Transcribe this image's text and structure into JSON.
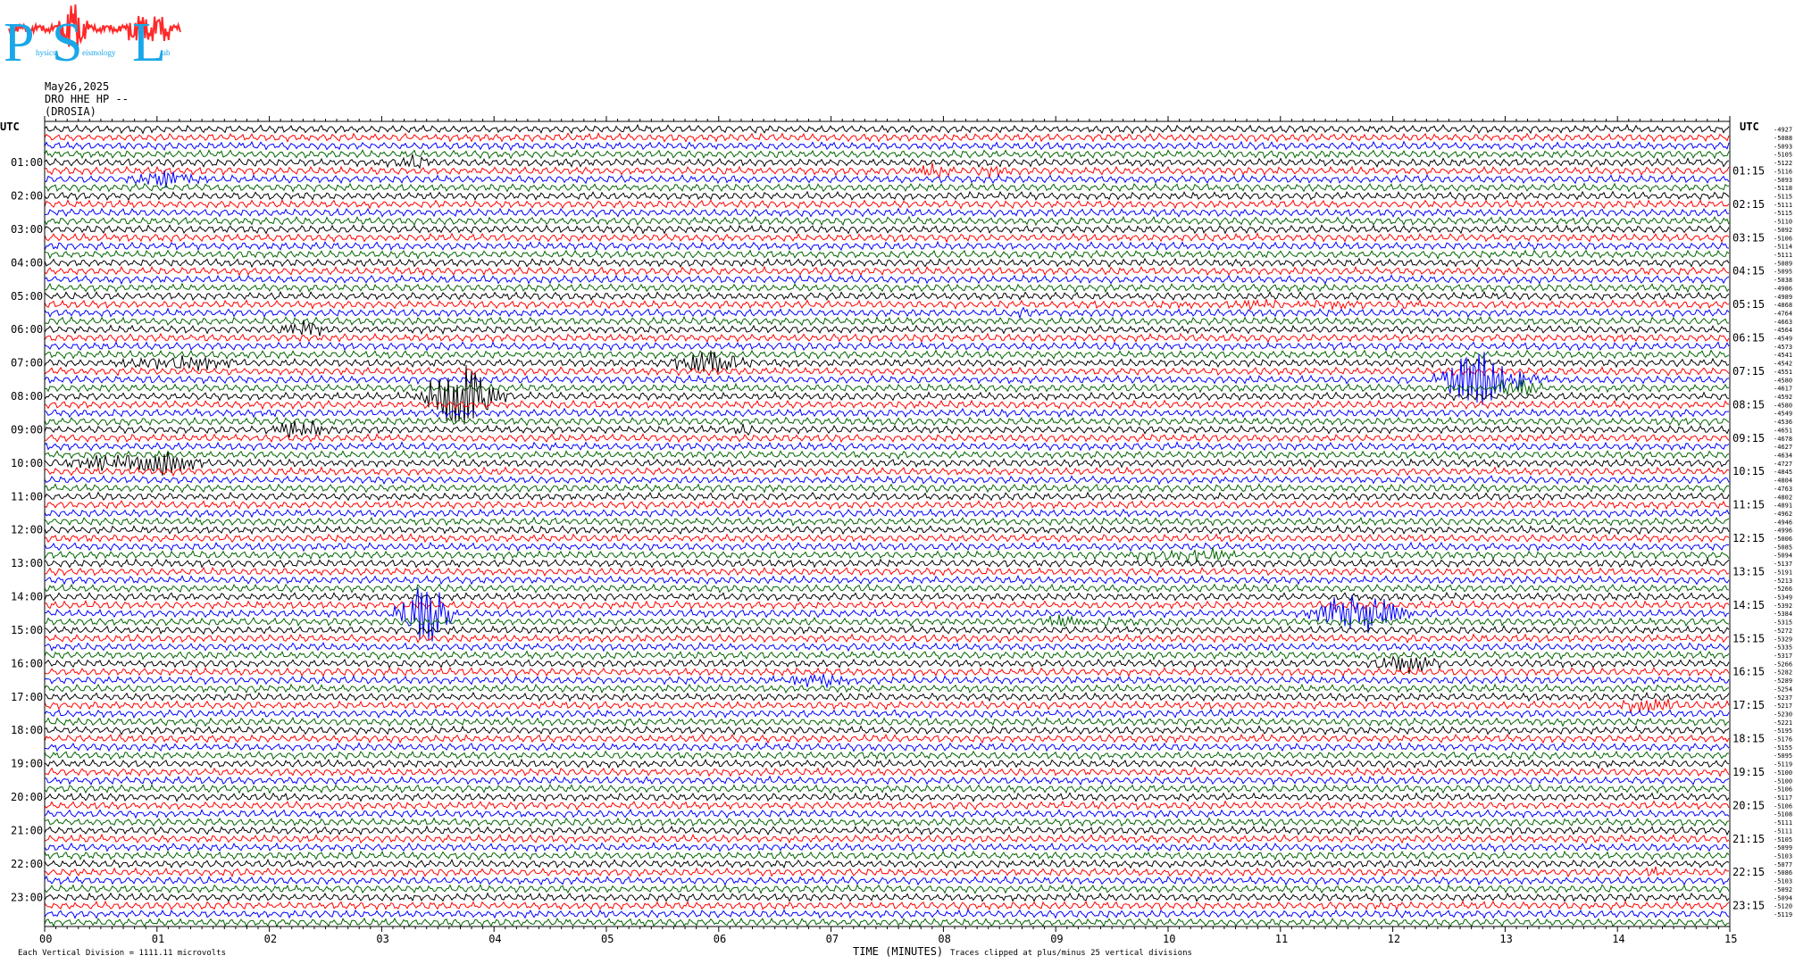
{
  "logo": {
    "letters": [
      "P",
      "S",
      "L"
    ],
    "subtitle_fragments": [
      "hysics",
      "eismology",
      "ab"
    ],
    "colors": {
      "letters": "#1aa7e8",
      "trace": "#ff2a2a"
    }
  },
  "header": {
    "date": "May26,2025",
    "channel": "DRO HHE HP --",
    "station": "(DROSIA)"
  },
  "footer": {
    "left_note": "Each Vertical Division = 1111.11 microvolts",
    "x_axis_label": "TIME (MINUTES)",
    "clip_note": "Traces clipped at plus/minus 25 vertical divisions"
  },
  "chart_data": {
    "type": "line",
    "title": "",
    "xlabel": "TIME (MINUTES)",
    "ylabel": "UTC",
    "xlim": [
      0,
      15
    ],
    "x_ticks": [
      "00",
      "01",
      "02",
      "03",
      "04",
      "05",
      "06",
      "07",
      "08",
      "09",
      "10",
      "11",
      "12",
      "13",
      "14",
      "15"
    ],
    "left_axis_title": "UTC",
    "right_axis_title": "UTC",
    "left_hour_labels": [
      "01:00",
      "02:00",
      "03:00",
      "04:00",
      "05:00",
      "06:00",
      "07:00",
      "08:00",
      "09:00",
      "10:00",
      "11:00",
      "12:00",
      "13:00",
      "14:00",
      "15:00",
      "16:00",
      "17:00",
      "18:00",
      "19:00",
      "20:00",
      "21:00",
      "22:00",
      "23:00"
    ],
    "right_hour_labels": [
      "01:15",
      "02:15",
      "03:15",
      "04:15",
      "05:15",
      "06:15",
      "07:15",
      "08:15",
      "09:15",
      "10:15",
      "11:15",
      "12:15",
      "13:15",
      "14:15",
      "15:15",
      "16:15",
      "17:15",
      "18:15",
      "19:15",
      "20:15",
      "21:15",
      "22:15",
      "23:15"
    ],
    "trace_count": 96,
    "minutes_per_trace": 15,
    "trace_color_cycle": [
      "#000000",
      "#ff0000",
      "#0000ff",
      "#006400"
    ],
    "trace_offsets": [
      "-4927",
      "-5088",
      "-5093",
      "-5105",
      "-5122",
      "-5116",
      "-5093",
      "-5118",
      "-5115",
      "-5111",
      "-5115",
      "-5110",
      "-5092",
      "-5106",
      "-5114",
      "-5111",
      "-5089",
      "-5095",
      "-5038",
      "-4986",
      "-4989",
      "-4868",
      "-4764",
      "-4663",
      "-4564",
      "-4549",
      "-4573",
      "-4541",
      "-4542",
      "-4551",
      "-4580",
      "-4617",
      "-4592",
      "-4580",
      "-4549",
      "-4536",
      "-4651",
      "-4678",
      "-4627",
      "-4634",
      "-4727",
      "-4845",
      "-4804",
      "-4763",
      "-4802",
      "-4891",
      "-4962",
      "-4946",
      "-4996",
      "-5006",
      "-5085",
      "-5094",
      "-5137",
      "-5191",
      "-5213",
      "-5266",
      "-5349",
      "-5392",
      "-5384",
      "-5315",
      "-5272",
      "-5329",
      "-5335",
      "-5317",
      "-5266",
      "-5282",
      "-5289",
      "-5254",
      "-5237",
      "-5217",
      "-5230",
      "-5221",
      "-5195",
      "-5176",
      "-5155",
      "-5095",
      "-5119",
      "-5100",
      "-5100",
      "-5106",
      "-5117",
      "-5106",
      "-5108",
      "-5111",
      "-5111",
      "-5105",
      "-5099",
      "-5103",
      "-5077",
      "-5086",
      "-5103",
      "-5092",
      "-5094",
      "-5120",
      "-5119"
    ],
    "events": [
      {
        "trace": 4,
        "minute": 3.3,
        "amp": 10,
        "width": 0.15
      },
      {
        "trace": 6,
        "minute": 1.1,
        "amp": 9,
        "width": 0.35
      },
      {
        "trace": 5,
        "minute": 7.9,
        "amp": 5,
        "width": 0.2
      },
      {
        "trace": 5,
        "minute": 8.4,
        "amp": 5,
        "width": 0.15
      },
      {
        "trace": 22,
        "minute": 8.7,
        "amp": 6,
        "width": 0.15
      },
      {
        "trace": 21,
        "minute": 11.0,
        "amp": 3,
        "width": 1.4
      },
      {
        "trace": 24,
        "minute": 2.3,
        "amp": 9,
        "width": 0.2
      },
      {
        "trace": 28,
        "minute": 1.2,
        "amp": 8,
        "width": 0.5
      },
      {
        "trace": 28,
        "minute": 5.9,
        "amp": 12,
        "width": 0.35
      },
      {
        "trace": 32,
        "minute": 3.7,
        "amp": 40,
        "width": 0.3
      },
      {
        "trace": 30,
        "minute": 12.8,
        "amp": 40,
        "width": 0.3
      },
      {
        "trace": 31,
        "minute": 13.1,
        "amp": 10,
        "width": 0.2
      },
      {
        "trace": 36,
        "minute": 2.3,
        "amp": 9,
        "width": 0.3
      },
      {
        "trace": 36,
        "minute": 6.2,
        "amp": 7,
        "width": 0.1
      },
      {
        "trace": 40,
        "minute": 0.8,
        "amp": 9,
        "width": 0.6
      },
      {
        "trace": 40,
        "minute": 1.1,
        "amp": 7,
        "width": 0.2
      },
      {
        "trace": 51,
        "minute": 10.2,
        "amp": 7,
        "width": 0.4
      },
      {
        "trace": 58,
        "minute": 3.4,
        "amp": 40,
        "width": 0.2
      },
      {
        "trace": 58,
        "minute": 11.7,
        "amp": 30,
        "width": 0.3
      },
      {
        "trace": 59,
        "minute": 9.2,
        "amp": 5,
        "width": 0.4
      },
      {
        "trace": 64,
        "minute": 12.1,
        "amp": 9,
        "width": 0.3
      },
      {
        "trace": 66,
        "minute": 6.8,
        "amp": 8,
        "width": 0.3
      },
      {
        "trace": 69,
        "minute": 14.3,
        "amp": 8,
        "width": 0.3
      },
      {
        "trace": 89,
        "minute": 14.3,
        "amp": 4,
        "width": 0.1
      }
    ]
  }
}
